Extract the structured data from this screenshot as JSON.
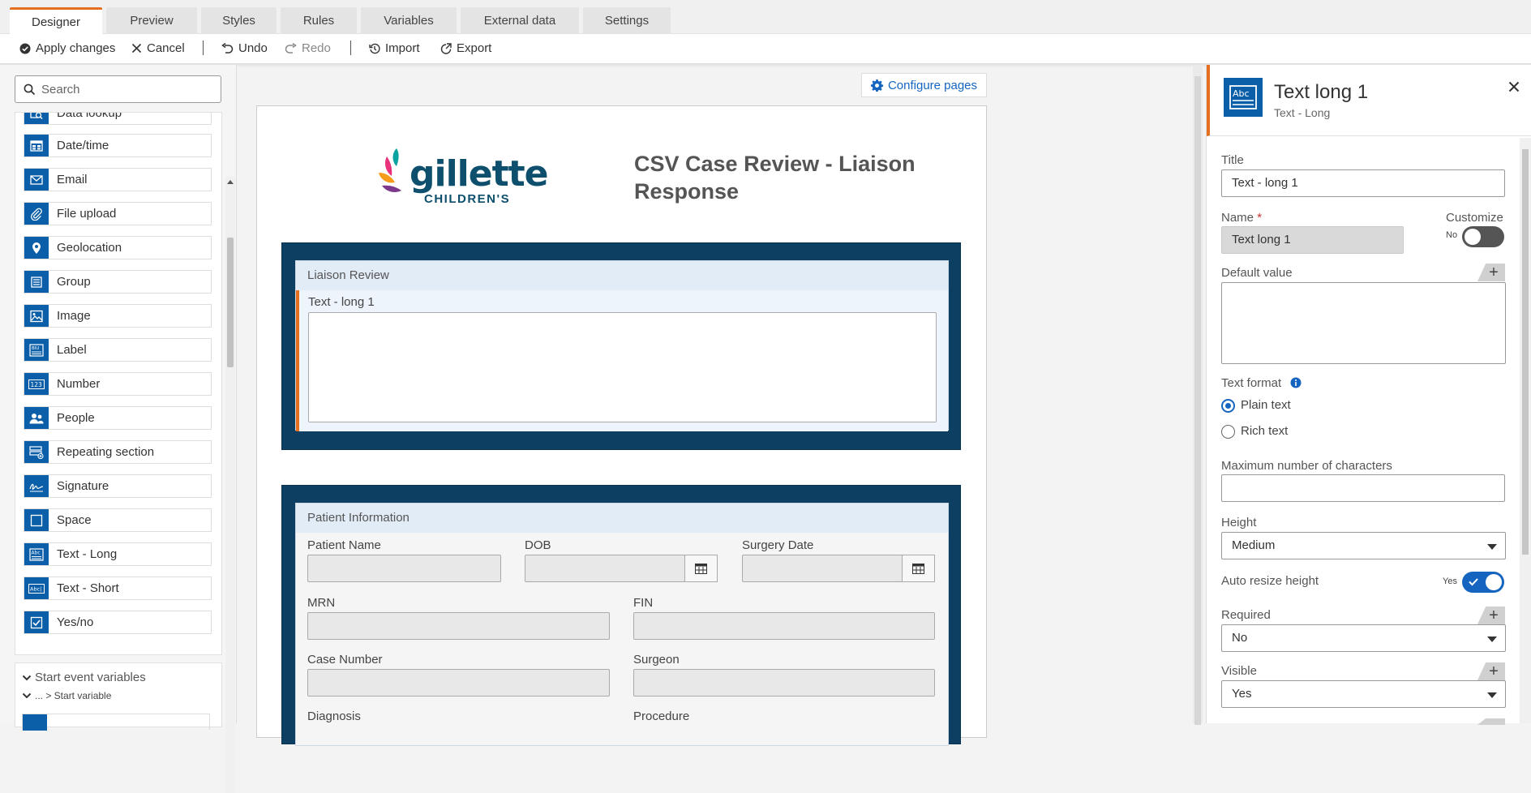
{
  "tabs": [
    "Designer",
    "Preview",
    "Styles",
    "Rules",
    "Variables",
    "External data",
    "Settings"
  ],
  "toolbar": {
    "apply": "Apply changes",
    "cancel": "Cancel",
    "undo": "Undo",
    "redo": "Redo",
    "import": "Import",
    "export": "Export"
  },
  "search": {
    "placeholder": "Search"
  },
  "tools": [
    {
      "label": "Data lookup",
      "icon": "data-lookup-icon"
    },
    {
      "label": "Date/time",
      "icon": "datetime-icon"
    },
    {
      "label": "Email",
      "icon": "email-icon"
    },
    {
      "label": "File upload",
      "icon": "paperclip-icon"
    },
    {
      "label": "Geolocation",
      "icon": "location-pin-icon"
    },
    {
      "label": "Group",
      "icon": "group-icon"
    },
    {
      "label": "Image",
      "icon": "image-icon"
    },
    {
      "label": "Label",
      "icon": "label-icon"
    },
    {
      "label": "Number",
      "icon": "number-icon"
    },
    {
      "label": "People",
      "icon": "people-icon"
    },
    {
      "label": "Repeating section",
      "icon": "repeating-section-icon"
    },
    {
      "label": "Signature",
      "icon": "signature-icon"
    },
    {
      "label": "Space",
      "icon": "space-icon"
    },
    {
      "label": "Text - Long",
      "icon": "text-long-icon"
    },
    {
      "label": "Text - Short",
      "icon": "text-short-icon"
    },
    {
      "label": "Yes/no",
      "icon": "checkbox-icon"
    }
  ],
  "variables": {
    "start_event": "Start event variables",
    "start_variable": "... > Start variable"
  },
  "canvas": {
    "configure_pages": "Configure pages",
    "logo_text": "gillette",
    "logo_sub": "CHILDREN'S",
    "form_title_line1": "CSV Case Review - Liaison",
    "form_title_line2": "Response",
    "section1": {
      "title": "Liaison Review",
      "field_label": "Text - long 1"
    },
    "section2": {
      "title": "Patient Information",
      "patient_name": "Patient Name",
      "dob": "DOB",
      "surgery_date": "Surgery Date",
      "mrn": "MRN",
      "fin": "FIN",
      "case_number": "Case Number",
      "surgeon": "Surgeon",
      "diagnosis": "Diagnosis",
      "procedure": "Procedure"
    }
  },
  "properties": {
    "title": "Text long 1",
    "subtitle": "Text - Long",
    "title_label": "Title",
    "title_value": "Text - long 1",
    "name_label": "Name",
    "required_star": "*",
    "name_value": "Text  long 1",
    "customize_label": "Customize",
    "customize_state": "No",
    "default_value_label": "Default value",
    "text_format_label": "Text format",
    "format_plain": "Plain text",
    "format_rich": "Rich text",
    "max_chars_label": "Maximum number of characters",
    "height_label": "Height",
    "height_value": "Medium",
    "auto_resize_label": "Auto resize height",
    "auto_resize_state": "Yes",
    "required_label": "Required",
    "required_value": "No",
    "visible_label": "Visible",
    "visible_value": "Yes"
  },
  "colors": {
    "accent": "#e56f1f",
    "brand_blue": "#0b5ea8",
    "section_navy": "#0d3f63",
    "link": "#1565c0"
  }
}
